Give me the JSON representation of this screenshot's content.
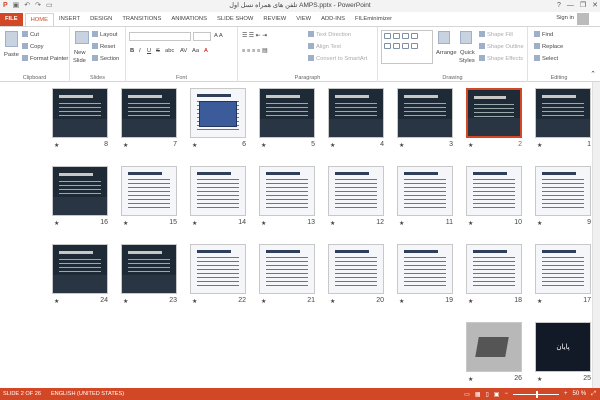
{
  "titlebar": {
    "title": "تلفن های همراه نسل اول AMPS.pptx - PowerPoint",
    "quick_access": [
      "save-icon",
      "undo-icon",
      "redo-icon",
      "start-from-beginning-icon"
    ],
    "window_controls": [
      "?",
      "—",
      "❐",
      "✕"
    ]
  },
  "tabs": [
    "FILE",
    "HOME",
    "INSERT",
    "DESIGN",
    "TRANSITIONS",
    "ANIMATIONS",
    "SLIDE SHOW",
    "REVIEW",
    "VIEW",
    "ADD-INS",
    "FILEminimizer"
  ],
  "active_tab": "HOME",
  "sign_in": "Sign in",
  "ribbon": {
    "clipboard": {
      "paste": "Paste",
      "cut": "Cut",
      "copy": "Copy",
      "format_painter": "Format Painter",
      "label": "Clipboard"
    },
    "slides": {
      "new_slide": "New",
      "new_slide2": "Slide",
      "layout": "Layout",
      "reset": "Reset",
      "section": "Section",
      "label": "Slides"
    },
    "font": {
      "label": "Font",
      "bold": "B",
      "italic": "I",
      "underline": "U",
      "strike": "S",
      "shadow": "abc",
      "spacing": "AV",
      "case": "Aa",
      "color": "A"
    },
    "paragraph": {
      "text_direction": "Text Direction",
      "align_text": "Align Text",
      "convert": "Convert to SmartArt",
      "label": "Paragraph"
    },
    "drawing": {
      "arrange": "Arrange",
      "quick_styles": "Quick",
      "quick_styles2": "Styles",
      "shape_fill": "Shape Fill",
      "shape_outline": "Shape Outline",
      "shape_effects": "Shape Effects",
      "label": "Drawing"
    },
    "editing": {
      "find": "Find",
      "replace": "Replace",
      "select": "Select",
      "label": "Editing"
    }
  },
  "slides": [
    {
      "n": "1",
      "style": "photo",
      "star": true,
      "selected": false
    },
    {
      "n": "2",
      "style": "photo",
      "star": true,
      "selected": true
    },
    {
      "n": "3",
      "style": "dark",
      "star": true,
      "selected": false
    },
    {
      "n": "4",
      "style": "dark",
      "star": true,
      "selected": false
    },
    {
      "n": "5",
      "style": "dark",
      "star": true,
      "selected": false
    },
    {
      "n": "6",
      "style": "table",
      "star": true,
      "selected": false
    },
    {
      "n": "7",
      "style": "dark",
      "star": true,
      "selected": false
    },
    {
      "n": "8",
      "style": "dark",
      "star": true,
      "selected": false
    },
    {
      "n": "9",
      "style": "light",
      "star": true,
      "selected": false
    },
    {
      "n": "10",
      "style": "light",
      "star": true,
      "selected": false
    },
    {
      "n": "11",
      "style": "light",
      "star": true,
      "selected": false
    },
    {
      "n": "12",
      "style": "light",
      "star": true,
      "selected": false
    },
    {
      "n": "13",
      "style": "light",
      "star": true,
      "selected": false
    },
    {
      "n": "14",
      "style": "light",
      "star": true,
      "selected": false
    },
    {
      "n": "15",
      "style": "light",
      "star": true,
      "selected": false
    },
    {
      "n": "16",
      "style": "dark",
      "star": true,
      "selected": false
    },
    {
      "n": "17",
      "style": "light",
      "star": true,
      "selected": false
    },
    {
      "n": "18",
      "style": "light",
      "star": true,
      "selected": false
    },
    {
      "n": "19",
      "style": "light",
      "star": true,
      "selected": false
    },
    {
      "n": "20",
      "style": "light",
      "star": true,
      "selected": false
    },
    {
      "n": "21",
      "style": "light",
      "star": true,
      "selected": false
    },
    {
      "n": "22",
      "style": "light",
      "star": true,
      "selected": false
    },
    {
      "n": "23",
      "style": "dark",
      "star": true,
      "selected": false
    },
    {
      "n": "24",
      "style": "dark",
      "star": true,
      "selected": false
    },
    {
      "n": "25",
      "style": "end",
      "star": true,
      "selected": false
    },
    {
      "n": "26",
      "style": "photo2",
      "star": true,
      "selected": false
    }
  ],
  "status": {
    "slide_of": "SLIDE 2 OF 26",
    "language": "ENGLISH (UNITED STATES)",
    "zoom": "50 %",
    "zoom_minus": "−",
    "zoom_plus": "+"
  },
  "end_slide_text": "پایان",
  "colors": {
    "accent": "#d24726"
  }
}
